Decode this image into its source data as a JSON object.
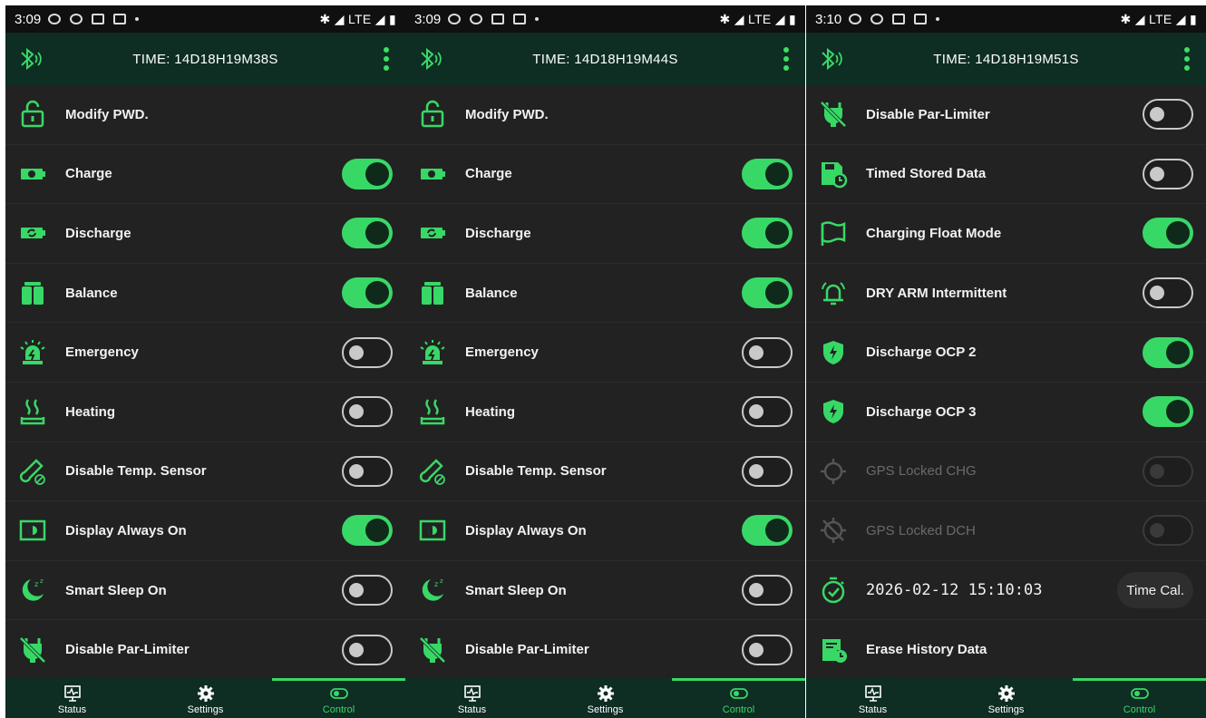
{
  "theme": {
    "accent": "#38d867",
    "appbar_bg": "#0e2d23",
    "list_bg": "#222222",
    "disabled_text": "#6a6a6a"
  },
  "status_bar": {
    "network": "LTE"
  },
  "nav": {
    "status": "Status",
    "settings": "Settings",
    "control": "Control",
    "active": "control"
  },
  "panels": [
    {
      "status_time": "3:09",
      "title": "TIME: 14D18H19M38S",
      "rows": [
        {
          "label": "Modify PWD.",
          "icon": "unlock-icon"
        },
        {
          "label": "Charge",
          "icon": "battery-charge-icon",
          "toggle": "on"
        },
        {
          "label": "Discharge",
          "icon": "battery-discharge-icon",
          "toggle": "on"
        },
        {
          "label": "Balance",
          "icon": "balance-batteries-icon",
          "toggle": "on"
        },
        {
          "label": "Emergency",
          "icon": "siren-icon",
          "toggle": "off"
        },
        {
          "label": "Heating",
          "icon": "heating-icon",
          "toggle": "off"
        },
        {
          "label": "Disable Temp. Sensor",
          "icon": "thermometer-off-icon",
          "toggle": "off"
        },
        {
          "label": "Display Always On",
          "icon": "display-icon",
          "toggle": "on"
        },
        {
          "label": "Smart Sleep On",
          "icon": "sleep-moon-icon",
          "toggle": "off"
        },
        {
          "label": "Disable Par-Limiter",
          "icon": "plug-off-icon",
          "toggle": "off"
        }
      ]
    },
    {
      "status_time": "3:09",
      "title": "TIME: 14D18H19M44S",
      "rows": [
        {
          "label": "Modify PWD.",
          "icon": "unlock-icon"
        },
        {
          "label": "Charge",
          "icon": "battery-charge-icon",
          "toggle": "on"
        },
        {
          "label": "Discharge",
          "icon": "battery-discharge-icon",
          "toggle": "on"
        },
        {
          "label": "Balance",
          "icon": "balance-batteries-icon",
          "toggle": "on"
        },
        {
          "label": "Emergency",
          "icon": "siren-icon",
          "toggle": "off"
        },
        {
          "label": "Heating",
          "icon": "heating-icon",
          "toggle": "off"
        },
        {
          "label": "Disable Temp. Sensor",
          "icon": "thermometer-off-icon",
          "toggle": "off"
        },
        {
          "label": "Display Always On",
          "icon": "display-icon",
          "toggle": "on"
        },
        {
          "label": "Smart Sleep On",
          "icon": "sleep-moon-icon",
          "toggle": "off"
        },
        {
          "label": "Disable Par-Limiter",
          "icon": "plug-off-icon",
          "toggle": "off"
        }
      ]
    },
    {
      "status_time": "3:10",
      "title": "TIME: 14D18H19M51S",
      "rows": [
        {
          "label": "Disable Par-Limiter",
          "icon": "plug-off-icon",
          "toggle": "off"
        },
        {
          "label": "Timed Stored Data",
          "icon": "save-timer-icon",
          "toggle": "off"
        },
        {
          "label": "Charging Float Mode",
          "icon": "flag-icon",
          "toggle": "on"
        },
        {
          "label": "DRY ARM Intermittent",
          "icon": "alarm-bell-icon",
          "toggle": "off"
        },
        {
          "label": "Discharge OCP 2",
          "icon": "shield-bolt-icon",
          "toggle": "on"
        },
        {
          "label": "Discharge OCP 3",
          "icon": "shield-bolt-icon",
          "toggle": "on"
        },
        {
          "label": "GPS Locked CHG",
          "icon": "gps-icon",
          "toggle": "disabled"
        },
        {
          "label": "GPS Locked DCH",
          "icon": "gps-off-icon",
          "toggle": "disabled"
        },
        {
          "datetime": "2026-02-12 15:10:03",
          "icon": "stopwatch-icon",
          "button": "Time Cal."
        },
        {
          "label": "Erase History Data",
          "icon": "erase-history-icon"
        }
      ]
    }
  ]
}
